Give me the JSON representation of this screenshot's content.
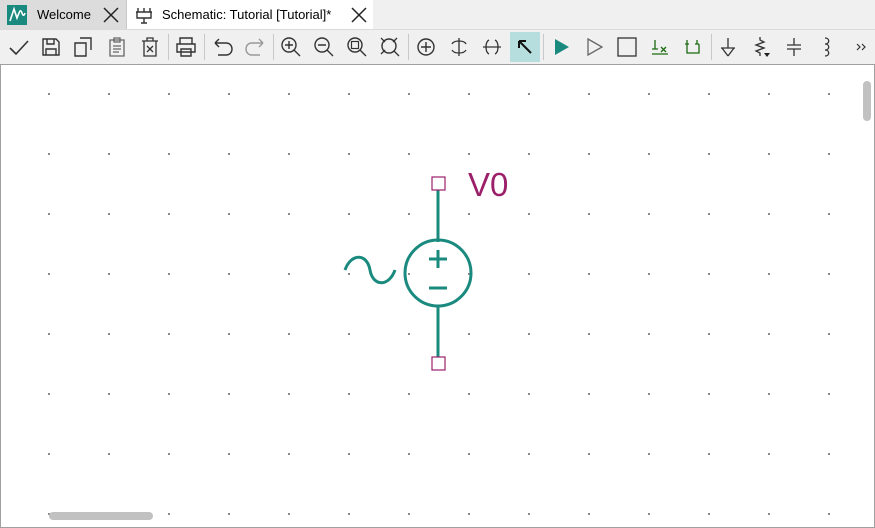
{
  "tabs": [
    {
      "label": "Welcome",
      "icon": "waveform-icon",
      "active": false
    },
    {
      "label": "Schematic: Tutorial [Tutorial]*",
      "icon": "schematic-icon",
      "active": true
    }
  ],
  "toolbar": {
    "items": [
      {
        "name": "check-icon"
      },
      {
        "name": "save-icon"
      },
      {
        "name": "save-as-icon"
      },
      {
        "name": "clipboard-icon"
      },
      {
        "name": "delete-icon"
      },
      {
        "name": "print-icon"
      },
      {
        "name": "undo-icon"
      },
      {
        "name": "redo-icon"
      },
      {
        "name": "zoom-in-icon"
      },
      {
        "name": "zoom-out-icon"
      },
      {
        "name": "zoom-fit-icon"
      },
      {
        "name": "zoom-selection-icon"
      },
      {
        "name": "rotate-icon"
      },
      {
        "name": "flip-vertical-icon"
      },
      {
        "name": "flip-horizontal-icon"
      },
      {
        "name": "pointer-icon",
        "active": true
      },
      {
        "name": "run-simulation-icon"
      },
      {
        "name": "step-icon"
      },
      {
        "name": "stop-icon"
      },
      {
        "name": "probe-icon"
      },
      {
        "name": "ground-probe-icon"
      },
      {
        "name": "ground-icon"
      },
      {
        "name": "resistor-icon"
      },
      {
        "name": "capacitor-icon"
      },
      {
        "name": "inductor-icon"
      },
      {
        "name": "more-icon"
      }
    ]
  },
  "schematic": {
    "component_label": "V0",
    "component_type": "ac-voltage-source",
    "wire_color": "#1a8a7e",
    "pin_color": "#9c1f6a",
    "label_color": "#9c1f6a"
  }
}
